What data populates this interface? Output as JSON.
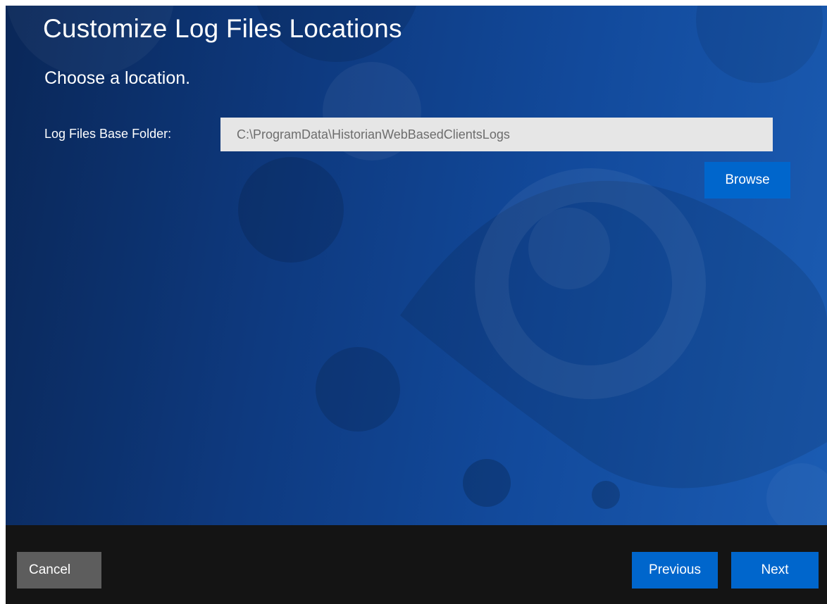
{
  "window": {
    "title": "Customize Log Files Locations",
    "subtitle": "Choose a location."
  },
  "form": {
    "log_folder_label": "Log Files Base Folder:",
    "log_folder_value": "C:\\ProgramData\\HistorianWebBasedClientsLogs",
    "browse_label": "Browse"
  },
  "footer": {
    "cancel_label": "Cancel",
    "previous_label": "Previous",
    "next_label": "Next"
  },
  "colors": {
    "background_dark": "#0a2758",
    "background_light": "#1b5cb3",
    "primary_button": "#0066cc",
    "cancel_button": "#5d5d5d",
    "footer_bar": "#141414",
    "input_background": "#e6e6e6",
    "input_text": "#6d6d6d"
  }
}
